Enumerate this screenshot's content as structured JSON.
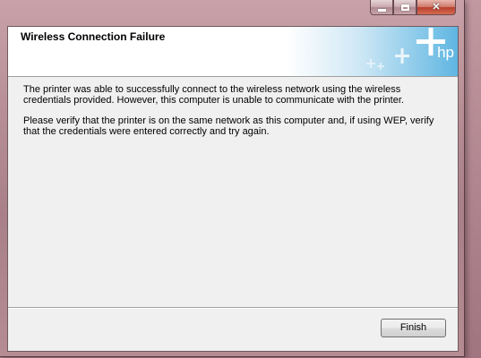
{
  "window": {
    "caption_buttons": {
      "minimize_icon": "minimize-icon",
      "maximize_icon": "maximize-icon",
      "close_glyph": "✕"
    }
  },
  "dialog": {
    "title": "Wireless Connection Failure",
    "logo_text": "hp",
    "paragraphs": [
      "The printer was able to successfully connect to the wireless network using the wireless credentials provided.  However, this computer is unable to communicate with the printer.",
      "Please verify that the printer is on the same network as this computer and, if using WEP, verify that the credentials were entered correctly and try again."
    ],
    "finish_label": "Finish"
  },
  "colors": {
    "header_accent": "#5fb6e2",
    "frame": "#b88f96",
    "client_bg": "#f0f0f0"
  }
}
